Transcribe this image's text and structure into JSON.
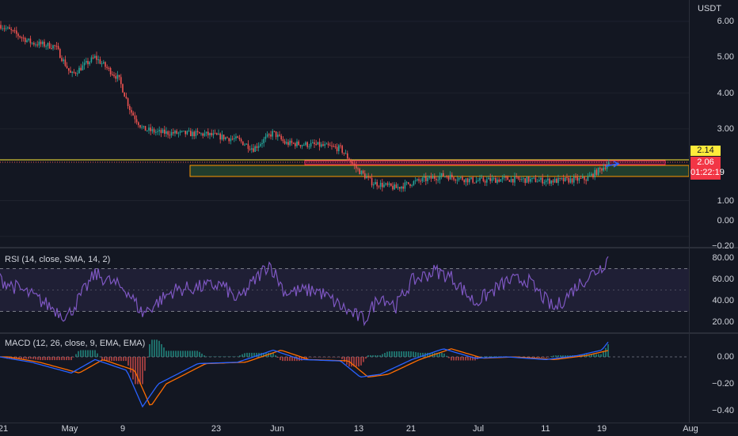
{
  "price_scale": {
    "currency": "USDT",
    "ticks": [
      "6.00",
      "5.00",
      "4.00",
      "3.00",
      "1.00",
      "0.00",
      "−0.20"
    ],
    "tick_values": [
      6.0,
      5.0,
      4.0,
      3.0,
      1.0,
      0.0,
      -0.2
    ],
    "yellow_tag": "2.14",
    "last_price": "2.06",
    "countdown": "01:22:19"
  },
  "rsi": {
    "title": "RSI (14, close, SMA, 14, 2)",
    "ticks": [
      "80.00",
      "60.00",
      "40.00",
      "20.00"
    ],
    "tick_values": [
      80,
      60,
      40,
      20
    ]
  },
  "macd": {
    "title": "MACD (12, 26, close, 9, EMA, EMA)",
    "ticks": [
      "0.00",
      "−0.20",
      "−0.40"
    ],
    "tick_values": [
      0,
      -0.2,
      -0.4
    ]
  },
  "time_axis": [
    "21",
    "May",
    "9",
    "23",
    "Jun",
    "13",
    "21",
    "Jul",
    "11",
    "19",
    "Aug"
  ],
  "colors": {
    "up": "#26a69a",
    "down": "#ef5350",
    "rsi": "#7e57c2",
    "macd": "#2962ff",
    "signal": "#ff6d00",
    "yellow_line": "#ffeb3b",
    "zone": "#ff9800"
  }
}
